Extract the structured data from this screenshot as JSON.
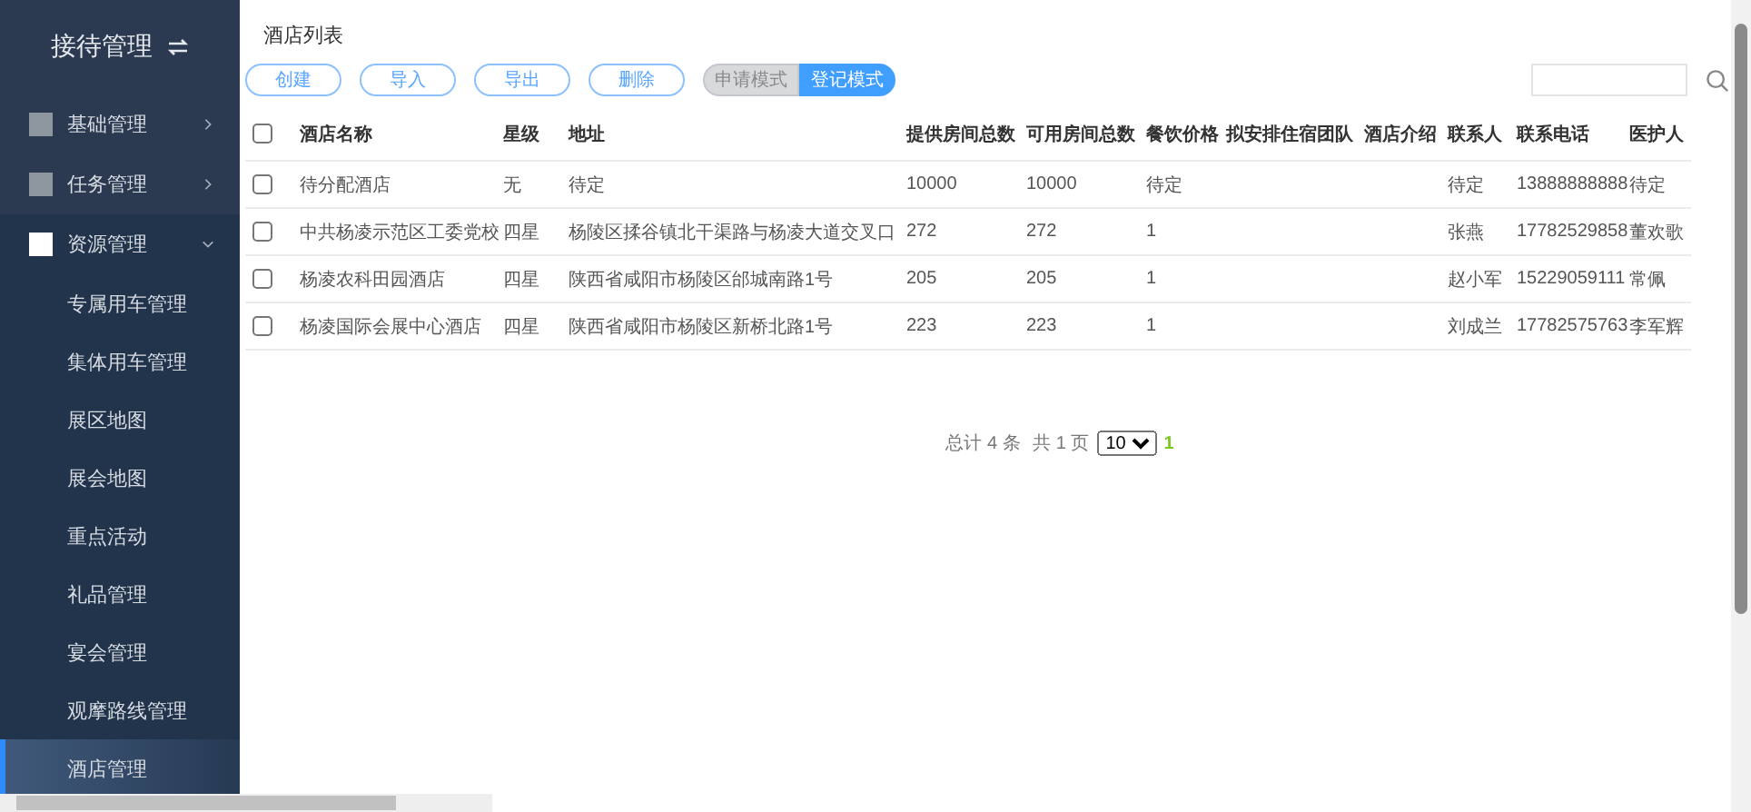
{
  "sidebar": {
    "title": "接待管理",
    "groups": [
      {
        "label": "基础管理",
        "expanded": false
      },
      {
        "label": "任务管理",
        "expanded": false
      },
      {
        "label": "资源管理",
        "expanded": true,
        "children": [
          {
            "label": "专属用车管理",
            "selected": false
          },
          {
            "label": "集体用车管理",
            "selected": false
          },
          {
            "label": "展区地图",
            "selected": false
          },
          {
            "label": "展会地图",
            "selected": false
          },
          {
            "label": "重点活动",
            "selected": false
          },
          {
            "label": "礼品管理",
            "selected": false
          },
          {
            "label": "宴会管理",
            "selected": false
          },
          {
            "label": "观摩路线管理",
            "selected": false
          },
          {
            "label": "酒店管理",
            "selected": true
          }
        ]
      }
    ]
  },
  "page_title": "酒店列表",
  "actions": [
    "创建",
    "导入",
    "导出",
    "删除"
  ],
  "modes": [
    {
      "label": "申请模式",
      "selected": false
    },
    {
      "label": "登记模式",
      "selected": true
    }
  ],
  "table": {
    "header_checked": false,
    "columns": [
      "酒店名称",
      "星级",
      "地址",
      "提供房间总数",
      "可用房间总数",
      "餐饮价格",
      "拟安排住宿团队",
      "酒店介绍",
      "联系人",
      "联系电话",
      "医护人"
    ],
    "rows": [
      {
        "checked": false,
        "cells": [
          "待分配酒店",
          "无",
          "待定",
          "10000",
          "10000",
          "待定",
          "",
          "",
          "待定",
          "13888888888",
          "待定"
        ]
      },
      {
        "checked": false,
        "cells": [
          "中共杨凌示范区工委党校",
          "四星",
          "杨陵区揉谷镇北干渠路与杨凌大道交叉口",
          "272",
          "272",
          "1",
          "",
          "",
          "张燕",
          "17782529858",
          "董欢歌"
        ]
      },
      {
        "checked": false,
        "cells": [
          "杨凌农科田园酒店",
          "四星",
          "陕西省咸阳市杨陵区邰城南路1号",
          "205",
          "205",
          "1",
          "",
          "",
          "赵小军",
          "15229059111",
          "常佩"
        ]
      },
      {
        "checked": false,
        "cells": [
          "杨凌国际会展中心酒店",
          "四星",
          "陕西省咸阳市杨陵区新桥北路1号",
          "223",
          "223",
          "1",
          "",
          "",
          "刘成兰",
          "17782575763",
          "李军辉"
        ]
      }
    ]
  },
  "pagination": {
    "total": "总计 4 条",
    "pages": "共 1 页",
    "page_size": "10",
    "current_page": "1"
  }
}
